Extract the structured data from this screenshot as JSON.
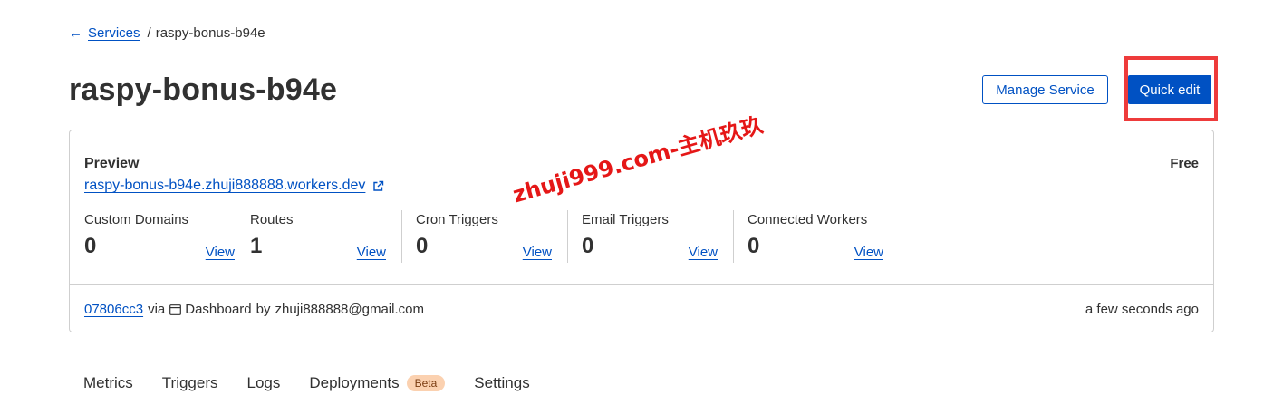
{
  "breadcrumb": {
    "back_label": "Services",
    "separator": "/",
    "current": "raspy-bonus-b94e"
  },
  "page": {
    "title": "raspy-bonus-b94e"
  },
  "actions": {
    "manage_label": "Manage Service",
    "quick_edit_label": "Quick edit"
  },
  "card": {
    "preview_label": "Preview",
    "plan": "Free",
    "preview_url": "raspy-bonus-b94e.zhuji888888.workers.dev",
    "stats": [
      {
        "label": "Custom Domains",
        "value": "0",
        "action": "View"
      },
      {
        "label": "Routes",
        "value": "1",
        "action": "View"
      },
      {
        "label": "Cron Triggers",
        "value": "0",
        "action": "View"
      },
      {
        "label": "Email Triggers",
        "value": "0",
        "action": "View"
      },
      {
        "label": "Connected Workers",
        "value": "0",
        "action": "View"
      }
    ],
    "footer": {
      "commit": "07806cc3",
      "via": "via",
      "source": "Dashboard",
      "by": "by",
      "author": "zhuji888888@gmail.com",
      "time": "a few seconds ago"
    }
  },
  "tabs": [
    {
      "label": "Metrics"
    },
    {
      "label": "Triggers"
    },
    {
      "label": "Logs"
    },
    {
      "label": "Deployments",
      "badge": "Beta"
    },
    {
      "label": "Settings"
    }
  ],
  "watermark": "zhuji999.com-主机玖玖",
  "colors": {
    "accent": "#0051c3",
    "highlight": "#ee3b3b",
    "badge_bg": "#fbd1b0",
    "border": "#cfcfcf",
    "text": "#313131"
  },
  "icons": {
    "back": "arrow-left-icon",
    "external": "external-link-icon",
    "dashboard": "browser-window-icon"
  }
}
